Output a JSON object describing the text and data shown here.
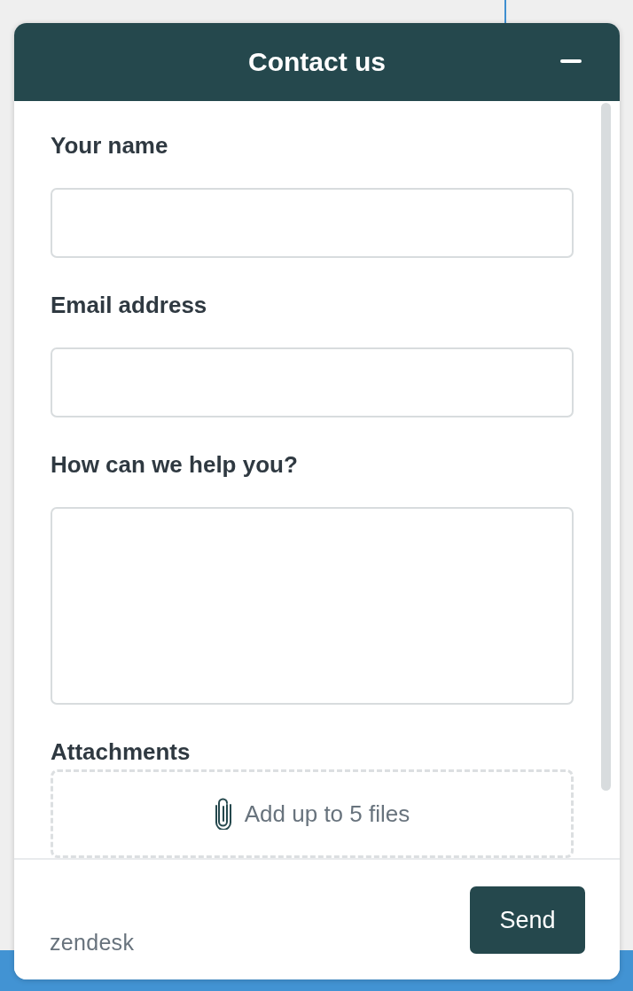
{
  "widget": {
    "title": "Contact us"
  },
  "fields": [
    {
      "label": "Your name",
      "kind": "input"
    },
    {
      "label": "Email address",
      "kind": "input"
    },
    {
      "label": "How can we help you?",
      "kind": "textarea"
    }
  ],
  "attachments": {
    "label": "Attachments",
    "dropzone_text": "Add up to 5 files"
  },
  "footer": {
    "brand": "zendesk",
    "send_button": "Send"
  }
}
